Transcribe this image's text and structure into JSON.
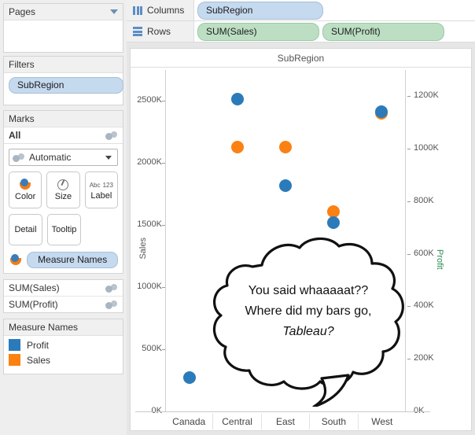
{
  "left_panel": {
    "pages": {
      "title": "Pages",
      "caret_icon": "chevron-down-icon"
    },
    "filters": {
      "title": "Filters",
      "pill": "SubRegion"
    },
    "marks": {
      "title": "Marks",
      "all_label": "All",
      "mark_type": "Automatic",
      "buttons": [
        {
          "label": "Color",
          "icon": "color-icon"
        },
        {
          "label": "Size",
          "icon": "size-icon"
        },
        {
          "label": "Label",
          "icon": "abc-123-icon"
        },
        {
          "label": "Detail",
          "icon": "detail-icon"
        },
        {
          "label": "Tooltip",
          "icon": "tooltip-icon"
        }
      ],
      "label_icon_line1": "Abc",
      "label_icon_line2": "123",
      "measure_names_pill": "Measure Names"
    },
    "measure_rows": [
      "SUM(Sales)",
      "SUM(Profit)"
    ],
    "legend": {
      "title": "Measure Names",
      "items": [
        {
          "label": "Profit",
          "color": "#2b7bba"
        },
        {
          "label": "Sales",
          "color": "#fb8113"
        }
      ]
    }
  },
  "shelves": {
    "columns": {
      "label": "Columns",
      "icon": "columns-icon",
      "pills": [
        "SubRegion"
      ]
    },
    "rows": {
      "label": "Rows",
      "icon": "rows-icon",
      "pills": [
        "SUM(Sales)",
        "SUM(Profit)"
      ]
    }
  },
  "viz": {
    "title": "SubRegion",
    "speech_bubble": {
      "line1": "You said whaaaaat??",
      "line2": "Where did my bars go,",
      "line3": "Tableau?"
    }
  },
  "chart_data": {
    "type": "scatter",
    "title": "SubRegion",
    "xlabel": "",
    "categories": [
      "Canada",
      "Central",
      "East",
      "South",
      "West"
    ],
    "grid": false,
    "legend_position": "left-panel",
    "axes": {
      "left": {
        "label": "Sales",
        "ticks": [
          "0K",
          "500K",
          "1000K",
          "1500K",
          "2000K",
          "2500K"
        ],
        "tick_values": [
          0,
          500000,
          1000000,
          1500000,
          2000000,
          2500000
        ],
        "ylim": [
          0,
          2750000
        ]
      },
      "right": {
        "label": "Profit",
        "ticks": [
          "0K",
          "200K",
          "400K",
          "600K",
          "800K",
          "1000K",
          "1200K"
        ],
        "tick_values": [
          0,
          200000,
          400000,
          600000,
          800000,
          1000000,
          1200000
        ],
        "ylim": [
          0,
          1300000
        ]
      }
    },
    "series": [
      {
        "name": "Sales",
        "color": "#fb8113",
        "axis": "left",
        "values": [
          null,
          2130000,
          2130000,
          1610000,
          2400000
        ]
      },
      {
        "name": "Profit",
        "color": "#2b7bba",
        "axis": "right",
        "values": [
          130000,
          1190000,
          860000,
          720000,
          1140000
        ]
      }
    ],
    "points": [
      {
        "category": "Canada",
        "series": "Profit",
        "value": 130000,
        "color": "#2b7bba"
      },
      {
        "category": "Central",
        "series": "Profit",
        "value": 1190000,
        "color": "#2b7bba"
      },
      {
        "category": "Central",
        "series": "Sales",
        "value": 2130000,
        "color": "#fb8113"
      },
      {
        "category": "East",
        "series": "Sales",
        "value": 2130000,
        "color": "#fb8113"
      },
      {
        "category": "East",
        "series": "Profit",
        "value": 860000,
        "color": "#2b7bba"
      },
      {
        "category": "South",
        "series": "Sales",
        "value": 1610000,
        "color": "#fb8113"
      },
      {
        "category": "South",
        "series": "Profit",
        "value": 720000,
        "color": "#2b7bba"
      },
      {
        "category": "West",
        "series": "Sales",
        "value": 2400000,
        "color": "#fb8113"
      },
      {
        "category": "West",
        "series": "Profit",
        "value": 1140000,
        "color": "#2b7bba"
      }
    ]
  }
}
